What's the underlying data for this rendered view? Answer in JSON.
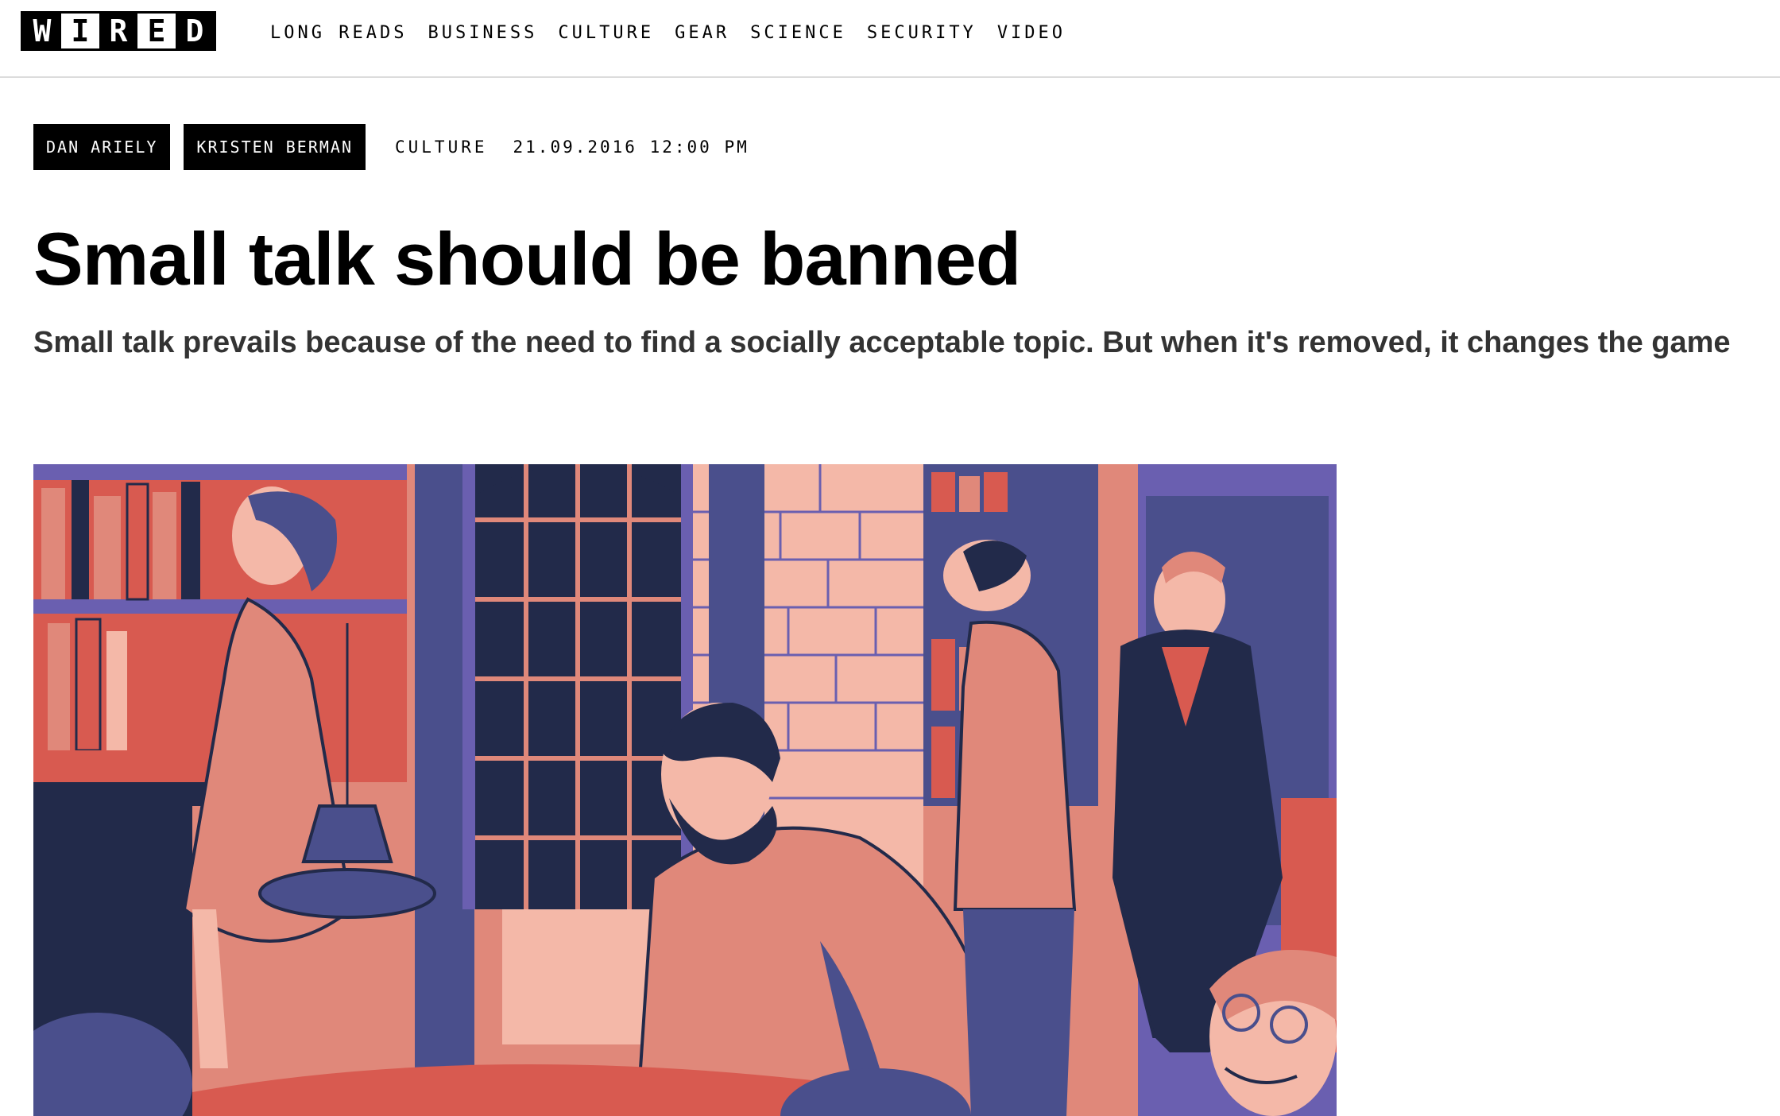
{
  "header": {
    "logo": {
      "letters": [
        "W",
        "I",
        "R",
        "E",
        "D"
      ]
    },
    "nav": [
      {
        "label": "LONG READS"
      },
      {
        "label": "BUSINESS"
      },
      {
        "label": "CULTURE"
      },
      {
        "label": "GEAR"
      },
      {
        "label": "SCIENCE"
      },
      {
        "label": "SECURITY"
      },
      {
        "label": "VIDEO"
      }
    ]
  },
  "article": {
    "authors": [
      {
        "name": "DAN ARIELY"
      },
      {
        "name": "KRISTEN BERMAN"
      }
    ],
    "category": "CULTURE",
    "date": "21.09.2016 12:00 PM",
    "title": "Small talk should be banned",
    "dek": "Small talk prevails because of the need to find a socially acceptable topic. But when it's removed, it changes the game"
  },
  "colors": {
    "text": "#000000",
    "dek": "#333333",
    "illustration_salmon": "#e0887a",
    "illustration_navy": "#222a4a",
    "illustration_purple": "#6a5fb0",
    "illustration_red": "#d85a50",
    "illustration_pink": "#f4b8a8"
  }
}
